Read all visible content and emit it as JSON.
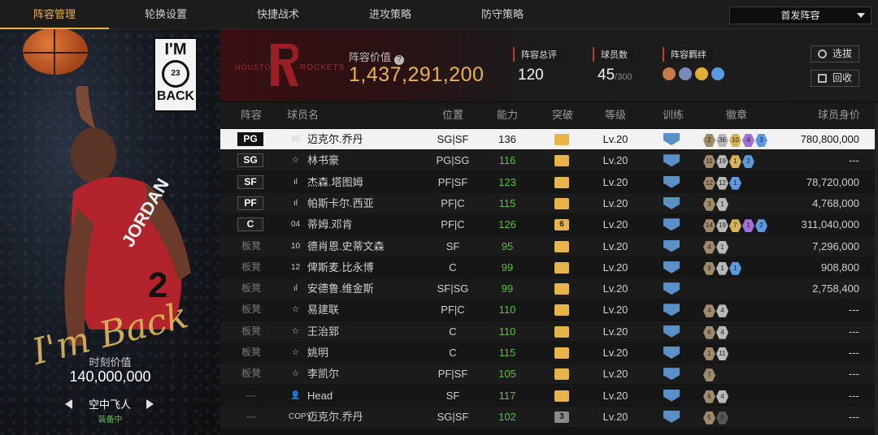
{
  "nav": {
    "tabs": [
      "阵容管理",
      "轮换设置",
      "快捷战术",
      "进攻策略",
      "防守策略"
    ],
    "active_tab": 0,
    "lineup_select": "首发阵容"
  },
  "card": {
    "logo_text_top": "I'M",
    "logo_text_mid": "23",
    "logo_text_bottom": "BACK",
    "jersey_text": "JORDAN",
    "signature": "I'm Back",
    "moment_label": "时刻价值",
    "moment_value": "140,000,000",
    "skill_name": "空中飞人",
    "equipped_label": "装备中"
  },
  "header": {
    "team_left_text": "HOUSTON",
    "team_right_text": "ROCKETS",
    "value_label": "阵容价值",
    "value": "1,437,291,200",
    "overall_label": "阵容总评",
    "overall": "120",
    "count_label": "球员数",
    "count": "45",
    "count_max": "/300",
    "chem_label": "阵容羁绊",
    "chem_icon_colors": [
      "#c47a4a",
      "#7a8bb5",
      "#e0b030",
      "#5b9ae0"
    ],
    "btn_pick": "选拔",
    "btn_recycle": "回收"
  },
  "table": {
    "headers": [
      "阵容",
      "球员名",
      "位置",
      "能力",
      "突破",
      "等级",
      "训练",
      "徽章",
      "球员身价"
    ],
    "rows": [
      {
        "slot": "PG",
        "type": "95",
        "name": "迈克尔.乔丹",
        "pos": "SG|SF",
        "ovr": "136",
        "break": "",
        "level": "Lv.20",
        "badges": [
          [
            "2",
            "#a08a6a"
          ],
          [
            "36",
            "#b8b8b8"
          ],
          [
            "10",
            "#d9b257"
          ],
          [
            "4",
            "#a070d8"
          ],
          [
            "3",
            "#5b9ae0"
          ]
        ],
        "worth": "780,800,000"
      },
      {
        "slot": "SG",
        "type": "☆",
        "name": "林书豪",
        "pos": "PG|SG",
        "ovr": "116",
        "break": "",
        "level": "Lv.20",
        "badges": [
          [
            "11",
            "#a08a6a"
          ],
          [
            "19",
            "#b8b8b8"
          ],
          [
            "1",
            "#d9b257"
          ],
          [
            "2",
            "#5b9ae0"
          ]
        ],
        "worth": "---"
      },
      {
        "slot": "SF",
        "type": "ıl",
        "name": "杰森.塔图姆",
        "pos": "PF|SF",
        "ovr": "123",
        "break": "",
        "level": "Lv.20",
        "badges": [
          [
            "12",
            "#a08a6a"
          ],
          [
            "12",
            "#b8b8b8"
          ],
          [
            "1",
            "#5b9ae0"
          ]
        ],
        "worth": "78,720,000"
      },
      {
        "slot": "PF",
        "type": "ıl",
        "name": "帕斯卡尔.西亚",
        "pos": "PF|C",
        "ovr": "115",
        "break": "",
        "level": "Lv.20",
        "badges": [
          [
            "3",
            "#a08a6a"
          ],
          [
            "1",
            "#b8b8b8"
          ]
        ],
        "worth": "4,768,000"
      },
      {
        "slot": "C",
        "type": "04",
        "name": "蒂姆.邓肯",
        "pos": "PF|C",
        "ovr": "126",
        "break": "6",
        "level": "Lv.20",
        "badges": [
          [
            "14",
            "#a08a6a"
          ],
          [
            "19",
            "#b8b8b8"
          ],
          [
            "7",
            "#d9b257"
          ],
          [
            "1",
            "#a070d8"
          ],
          [
            "2",
            "#5b9ae0"
          ]
        ],
        "worth": "311,040,000"
      },
      {
        "slot": "板凳",
        "type": "10",
        "name": "德肖恩.史蒂文森",
        "pos": "SF",
        "ovr": "95",
        "break": "",
        "level": "Lv.20",
        "badges": [
          [
            "4",
            "#a08a6a"
          ],
          [
            "1",
            "#b8b8b8"
          ]
        ],
        "worth": "7,296,000"
      },
      {
        "slot": "板凳",
        "type": "12",
        "name": "俾斯麦.比永博",
        "pos": "C",
        "ovr": "99",
        "break": "",
        "level": "Lv.20",
        "badges": [
          [
            "9",
            "#a08a6a"
          ],
          [
            "1",
            "#b8b8b8"
          ],
          [
            "1",
            "#5b9ae0"
          ]
        ],
        "worth": "908,800"
      },
      {
        "slot": "板凳",
        "type": "ıl",
        "name": "安德鲁.维金斯",
        "pos": "SF|SG",
        "ovr": "99",
        "break": "",
        "level": "Lv.20",
        "badges": [],
        "worth": "2,758,400"
      },
      {
        "slot": "板凳",
        "type": "☆",
        "name": "易建联",
        "pos": "PF|C",
        "ovr": "110",
        "break": "",
        "level": "Lv.20",
        "badges": [
          [
            "4",
            "#a08a6a"
          ],
          [
            "4",
            "#b8b8b8"
          ]
        ],
        "worth": "---"
      },
      {
        "slot": "板凳",
        "type": "☆",
        "name": "王治郅",
        "pos": "C",
        "ovr": "110",
        "break": "",
        "level": "Lv.20",
        "badges": [
          [
            "6",
            "#a08a6a"
          ],
          [
            "4",
            "#b8b8b8"
          ]
        ],
        "worth": "---"
      },
      {
        "slot": "板凳",
        "type": "☆",
        "name": "姚明",
        "pos": "C",
        "ovr": "115",
        "break": "",
        "level": "Lv.20",
        "badges": [
          [
            "1",
            "#a08a6a"
          ],
          [
            "11",
            "#b8b8b8"
          ]
        ],
        "worth": "---"
      },
      {
        "slot": "板凳",
        "type": "☆",
        "name": "李凯尔",
        "pos": "PF|SF",
        "ovr": "105",
        "break": "",
        "level": "Lv.20",
        "badges": [
          [
            "7",
            "#a08a6a"
          ]
        ],
        "worth": "---"
      },
      {
        "slot": "---",
        "type": "👤",
        "name": "Head",
        "pos": "SF",
        "ovr": "117",
        "break": "",
        "level": "Lv.20",
        "badges": [
          [
            "6",
            "#a08a6a"
          ],
          [
            "4",
            "#b8b8b8"
          ]
        ],
        "worth": "---"
      },
      {
        "slot": "---",
        "type": "COPY",
        "name": "迈克尔.乔丹",
        "pos": "SG|SF",
        "ovr": "102",
        "break": "3",
        "level": "Lv.20",
        "badges": [
          [
            "5",
            "#a08a6a"
          ],
          [
            "0",
            "#555555"
          ]
        ],
        "worth": "---"
      }
    ]
  },
  "colors": {
    "accent": "#e8b44a",
    "green": "#5ac13c",
    "team_red": "#c0392b"
  }
}
